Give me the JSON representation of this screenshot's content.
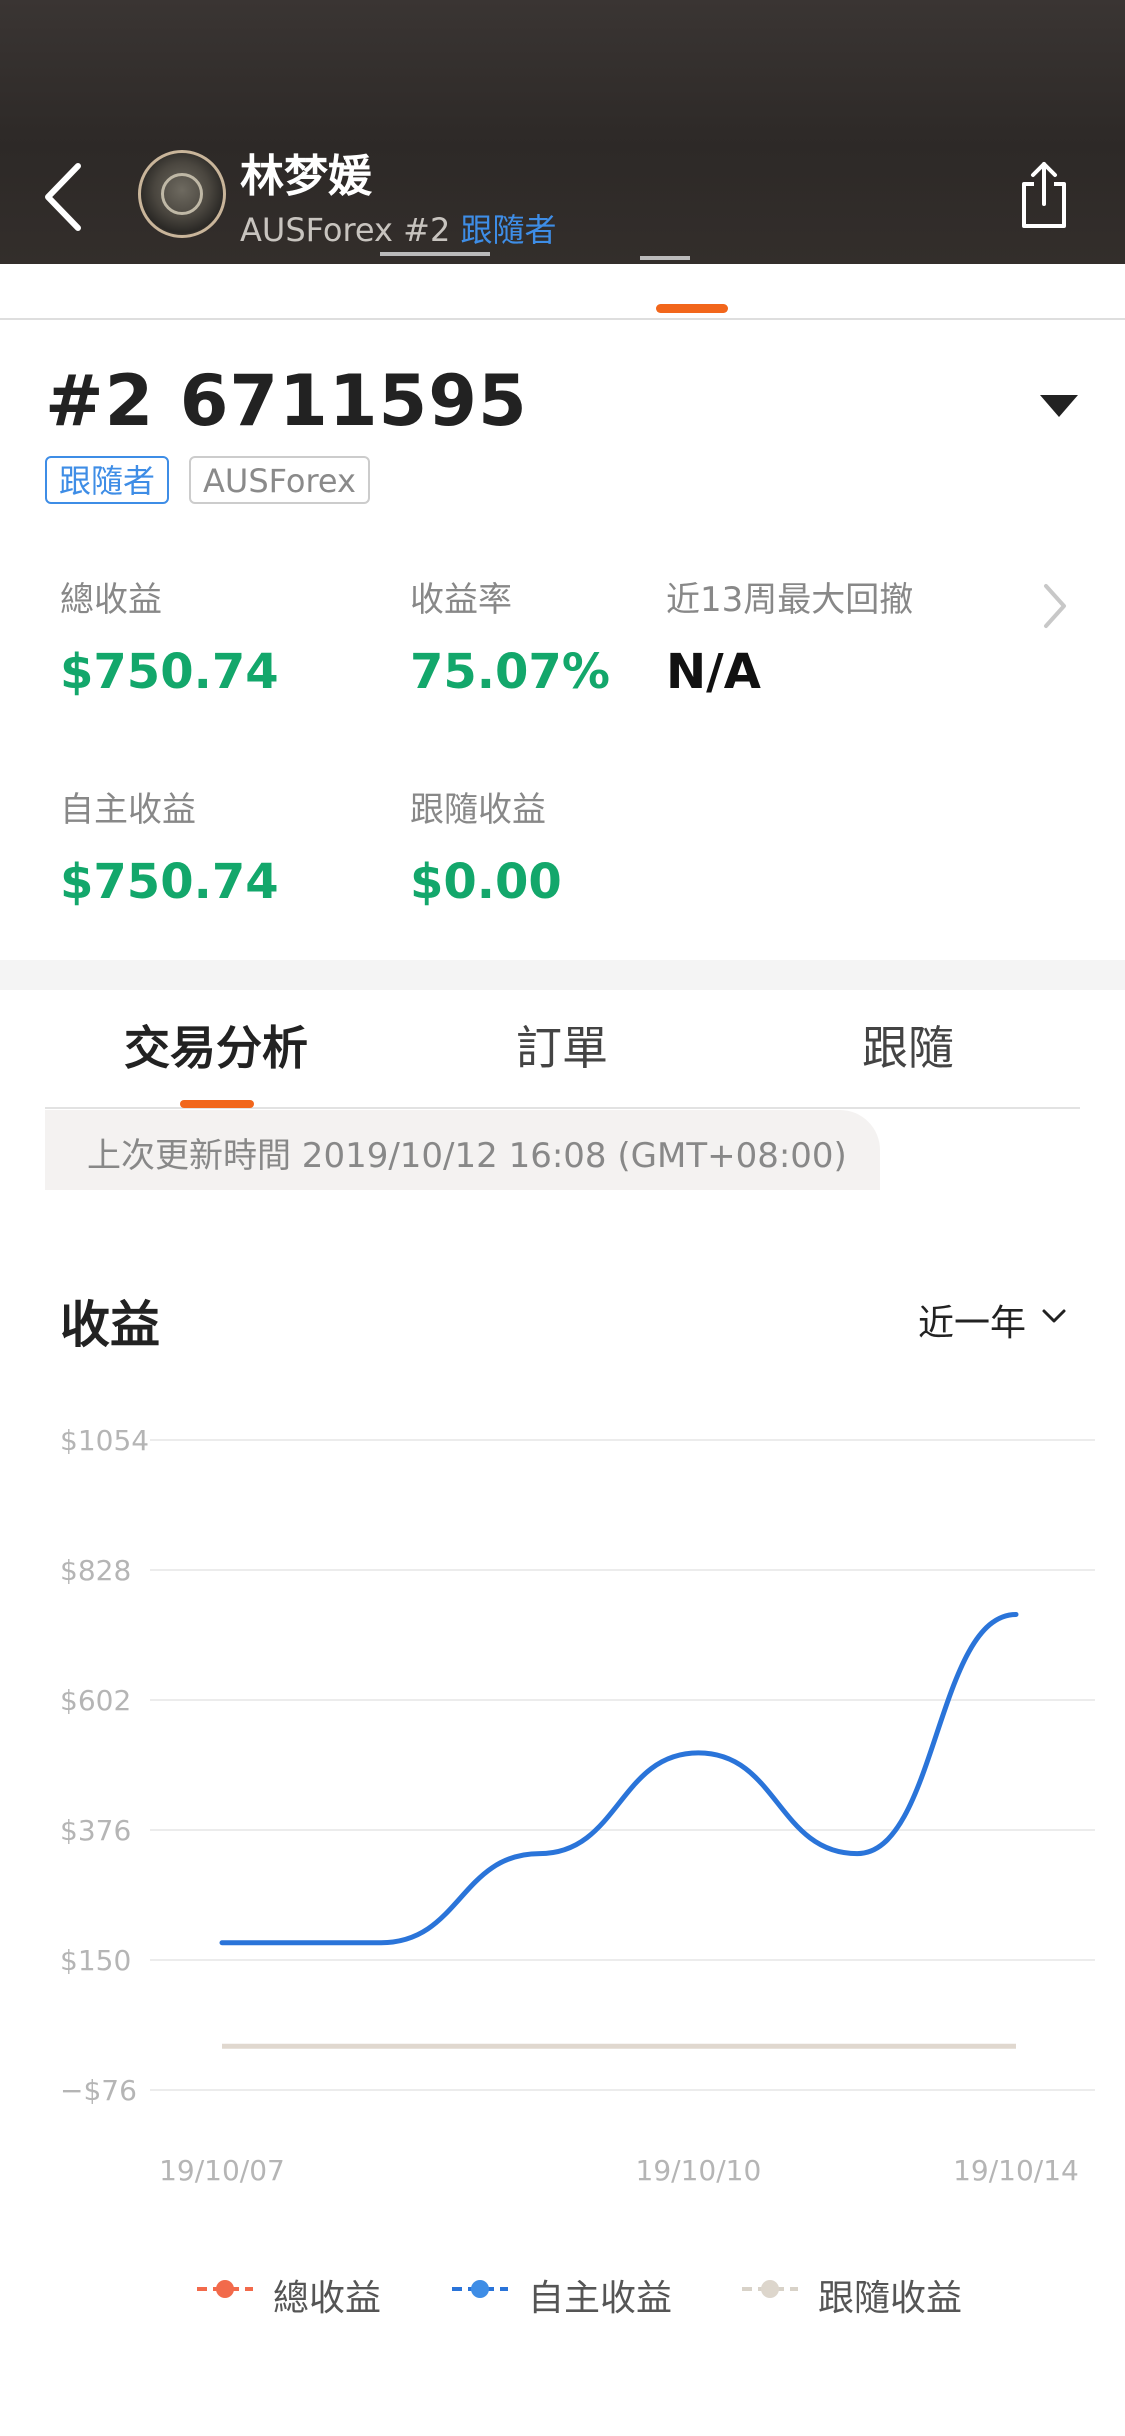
{
  "header": {
    "name": "林梦媛",
    "broker": "AUSForex",
    "account_no": "#2",
    "role": "跟隨者"
  },
  "account": {
    "title": "#2 6711595",
    "badge_role": "跟隨者",
    "badge_broker": "AUSForex"
  },
  "stats": [
    {
      "label": "總收益",
      "value": "$750.74",
      "color": "#13a76b"
    },
    {
      "label": "收益率",
      "value": "75.07%",
      "color": "#13a76b"
    },
    {
      "label": "近13周最大回撤",
      "value": "N/A",
      "color": "#111111"
    },
    {
      "label": "自主收益",
      "value": "$750.74",
      "color": "#13a76b"
    },
    {
      "label": "跟隨收益",
      "value": "$0.00",
      "color": "#13a76b"
    }
  ],
  "tabs": [
    {
      "label": "交易分析",
      "active": true
    },
    {
      "label": "訂單",
      "active": false
    },
    {
      "label": "跟隨",
      "active": false
    }
  ],
  "update_text": "上次更新時間 2019/10/12 16:08 (GMT+08:00)",
  "chart_section": {
    "title": "收益",
    "range": "近一年"
  },
  "chart_data": {
    "type": "line",
    "y_ticks": [
      "$1054",
      "$828",
      "$602",
      "$376",
      "$150",
      "−$76"
    ],
    "ylim": [
      -76,
      1054
    ],
    "x_ticks": [
      "19/10/07",
      "19/10/10",
      "19/10/14"
    ],
    "grid": true,
    "legend_position": "bottom",
    "series": [
      {
        "name": "總收益",
        "color": "#f26a4b",
        "values": []
      },
      {
        "name": "自主收益",
        "color": "#2a74d9",
        "points": [
          {
            "x": 0.0,
            "y": 180
          },
          {
            "x": 0.2,
            "y": 180
          },
          {
            "x": 0.4,
            "y": 335
          },
          {
            "x": 0.6,
            "y": 510
          },
          {
            "x": 0.8,
            "y": 335
          },
          {
            "x": 1.0,
            "y": 750.74
          }
        ]
      },
      {
        "name": "跟隨收益",
        "color": "#e0d8cf",
        "points": [
          {
            "x": 0.0,
            "y": 0
          },
          {
            "x": 1.0,
            "y": 0
          }
        ]
      }
    ]
  },
  "colors": {
    "accent": "#f2661b",
    "blue": "#3e8de6",
    "green": "#13a76b"
  }
}
